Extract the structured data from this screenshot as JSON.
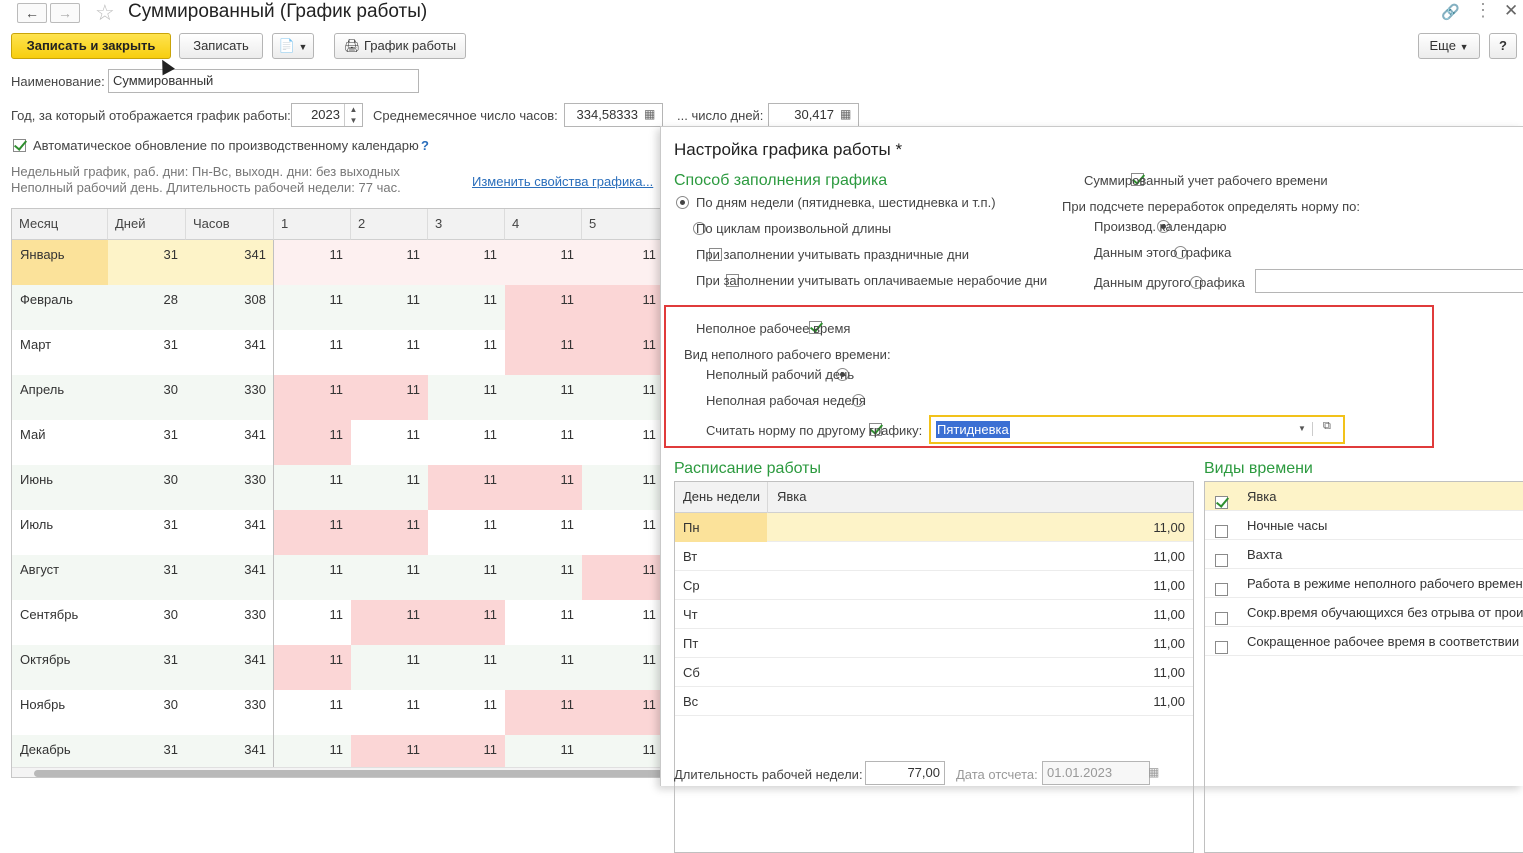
{
  "window": {
    "title": "Суммированный (График работы)"
  },
  "toolbar": {
    "save_close": "Записать и закрыть",
    "save": "Записать",
    "schedule": "График работы",
    "more": "Еще",
    "help": "?"
  },
  "form": {
    "name_label": "Наименование:",
    "name_value": "Суммированный",
    "year_label": "Год, за который отображается график работы:",
    "year_value": "2023",
    "avg_hours_label": "Среднемесячное число часов:",
    "avg_hours_value": "334,58333",
    "days_label": "... число дней:",
    "days_value": "30,417",
    "auto_update_label": "Автоматическое обновление по производственному календарю",
    "auto_update_help": "?",
    "info_line1": "Недельный график, раб. дни: Пн-Вс, выходн. дни: без выходных",
    "info_line2": "Неполный рабочий день. Длительность рабочей недели: 77 час.",
    "change_link": "Изменить свойства графика..."
  },
  "grid": {
    "headers": {
      "month": "Месяц",
      "days": "Дней",
      "hours": "Часов",
      "d1": "1",
      "d2": "2",
      "d3": "3",
      "d4": "4",
      "d5": "5"
    },
    "rows": [
      {
        "month": "Январь",
        "days": "31",
        "hours": "341",
        "d": [
          "11",
          "11",
          "11",
          "11",
          "11"
        ],
        "red": [
          0,
          0,
          0,
          0,
          0
        ],
        "pink": true,
        "selected": true
      },
      {
        "month": "Февраль",
        "days": "28",
        "hours": "308",
        "d": [
          "11",
          "11",
          "11",
          "11",
          "11"
        ],
        "red": [
          0,
          0,
          0,
          1,
          1
        ]
      },
      {
        "month": "Март",
        "days": "31",
        "hours": "341",
        "d": [
          "11",
          "11",
          "11",
          "11",
          "11"
        ],
        "red": [
          0,
          0,
          0,
          1,
          1
        ]
      },
      {
        "month": "Апрель",
        "days": "30",
        "hours": "330",
        "d": [
          "11",
          "11",
          "11",
          "11",
          "11"
        ],
        "red": [
          1,
          1,
          0,
          0,
          0
        ]
      },
      {
        "month": "Май",
        "days": "31",
        "hours": "341",
        "d": [
          "11",
          "11",
          "11",
          "11",
          "11"
        ],
        "red": [
          1,
          0,
          0,
          0,
          0
        ]
      },
      {
        "month": "Июнь",
        "days": "30",
        "hours": "330",
        "d": [
          "11",
          "11",
          "11",
          "11",
          "11"
        ],
        "red": [
          0,
          0,
          1,
          1,
          0
        ]
      },
      {
        "month": "Июль",
        "days": "31",
        "hours": "341",
        "d": [
          "11",
          "11",
          "11",
          "11",
          "11"
        ],
        "red": [
          1,
          1,
          0,
          0,
          0
        ]
      },
      {
        "month": "Август",
        "days": "31",
        "hours": "341",
        "d": [
          "11",
          "11",
          "11",
          "11",
          "11"
        ],
        "red": [
          0,
          0,
          0,
          0,
          1
        ]
      },
      {
        "month": "Сентябрь",
        "days": "30",
        "hours": "330",
        "d": [
          "11",
          "11",
          "11",
          "11",
          "11"
        ],
        "red": [
          0,
          1,
          1,
          0,
          0
        ]
      },
      {
        "month": "Октябрь",
        "days": "31",
        "hours": "341",
        "d": [
          "11",
          "11",
          "11",
          "11",
          "11"
        ],
        "red": [
          1,
          0,
          0,
          0,
          0
        ]
      },
      {
        "month": "Ноябрь",
        "days": "30",
        "hours": "330",
        "d": [
          "11",
          "11",
          "11",
          "11",
          "11"
        ],
        "red": [
          0,
          0,
          0,
          1,
          1
        ]
      },
      {
        "month": "Декабрь",
        "days": "31",
        "hours": "341",
        "d": [
          "11",
          "11",
          "11",
          "11",
          "11"
        ],
        "red": [
          0,
          1,
          1,
          0,
          0
        ]
      }
    ]
  },
  "panel": {
    "title": "Настройка графика работы *",
    "fill_method_title": "Способ заполнения графика",
    "fill_by_weekdays": "По дням недели (пятидневка, шестидневка и т.п.)",
    "fill_by_cycles": "По циклам произвольной длины",
    "consider_holidays": "При заполнении учитывать праздничные дни",
    "consider_paid_nonworking": "При заполнении учитывать оплачиваемые нерабочие дни",
    "summarized": "Суммированный учет рабочего времени",
    "overtime_label": "При подсчете переработок определять норму по:",
    "norm_prod_calendar": "Производ. календарю",
    "norm_this_schedule": "Данным этого графика",
    "norm_other_schedule": "Данным другого графика",
    "part_time": "Неполное рабочее время",
    "part_time_kind_label": "Вид неполного рабочего времени:",
    "part_day": "Неполный рабочий день",
    "part_week": "Неполная рабочая неделя",
    "norm_other_label": "Считать норму по другому графику:",
    "norm_other_value": "Пятидневка",
    "schedule_title": "Расписание работы",
    "schedule_head_day": "День недели",
    "schedule_head_attend": "Явка",
    "schedule": [
      {
        "day": "Пн",
        "value": "11,00"
      },
      {
        "day": "Вт",
        "value": "11,00"
      },
      {
        "day": "Ср",
        "value": "11,00"
      },
      {
        "day": "Чт",
        "value": "11,00"
      },
      {
        "day": "Пт",
        "value": "11,00"
      },
      {
        "day": "Сб",
        "value": "11,00"
      },
      {
        "day": "Вс",
        "value": "11,00"
      }
    ],
    "time_types_title": "Виды времени",
    "time_types": [
      {
        "label": "Явка",
        "checked": true
      },
      {
        "label": "Ночные часы",
        "checked": false
      },
      {
        "label": "Вахта",
        "checked": false
      },
      {
        "label": "Работа в режиме неполного рабочего времени",
        "checked": false
      },
      {
        "label": "Сокр.время обучающихся без отрыва от прои",
        "checked": false
      },
      {
        "label": "Сокращенное рабочее время в соответствии с",
        "checked": false
      }
    ],
    "week_length_label": "Длительность рабочей недели:",
    "week_length_value": "77,00",
    "ref_date_label": "Дата отсчета:",
    "ref_date_value": "01.01.2023"
  },
  "colors": {
    "accent_green": "#2c9a3f",
    "highlight_red": "#e03b3b",
    "yellow_button": "#f7ce0f",
    "weekend_pink": "#fbd6d6",
    "selected_row": "#fbe8a6"
  }
}
